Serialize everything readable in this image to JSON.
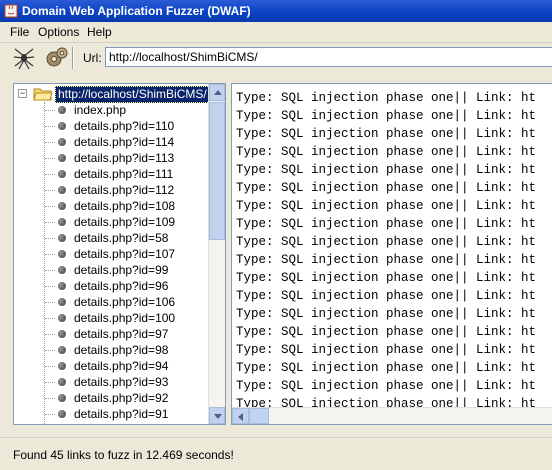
{
  "window": {
    "title": "Domain Web Application Fuzzer (DWAF)"
  },
  "menu": {
    "items": [
      "File",
      "Options",
      "Help"
    ]
  },
  "toolbar": {
    "buttons": [
      {
        "name": "spider-icon"
      },
      {
        "name": "gears-icon"
      }
    ],
    "url_label": "Url:",
    "url_value": "http://localhost/ShimBiCMS/"
  },
  "tree": {
    "root": "http://localhost/ShimBiCMS/",
    "items": [
      "index.php",
      "details.php?id=110",
      "details.php?id=114",
      "details.php?id=113",
      "details.php?id=111",
      "details.php?id=112",
      "details.php?id=108",
      "details.php?id=109",
      "details.php?id=58",
      "details.php?id=107",
      "details.php?id=99",
      "details.php?id=96",
      "details.php?id=106",
      "details.php?id=100",
      "details.php?id=97",
      "details.php?id=98",
      "details.php?id=94",
      "details.php?id=93",
      "details.php?id=92",
      "details.php?id=91"
    ]
  },
  "log": {
    "lines": [
      "Type: SQL injection phase one|| Link: ht",
      "Type: SQL injection phase one|| Link: ht",
      "Type: SQL injection phase one|| Link: ht",
      "Type: SQL injection phase one|| Link: ht",
      "Type: SQL injection phase one|| Link: ht",
      "Type: SQL injection phase one|| Link: ht",
      "Type: SQL injection phase one|| Link: ht",
      "Type: SQL injection phase one|| Link: ht",
      "Type: SQL injection phase one|| Link: ht",
      "Type: SQL injection phase one|| Link: ht",
      "Type: SQL injection phase one|| Link: ht",
      "Type: SQL injection phase one|| Link: ht",
      "Type: SQL injection phase one|| Link: ht",
      "Type: SQL injection phase one|| Link: ht",
      "Type: SQL injection phase one|| Link: ht",
      "Type: SQL injection phase one|| Link: ht",
      "Type: SQL injection phase one|| Link: ht",
      "Type: SQL injection phase one|| Link: ht"
    ]
  },
  "status": {
    "text": "Found 45 links to fuzz in 12.469 seconds!"
  },
  "colors": {
    "title_bar": "#0b44c3",
    "selection": "#0a246a",
    "window_bg": "#ece9d8",
    "border": "#7f9db9"
  }
}
